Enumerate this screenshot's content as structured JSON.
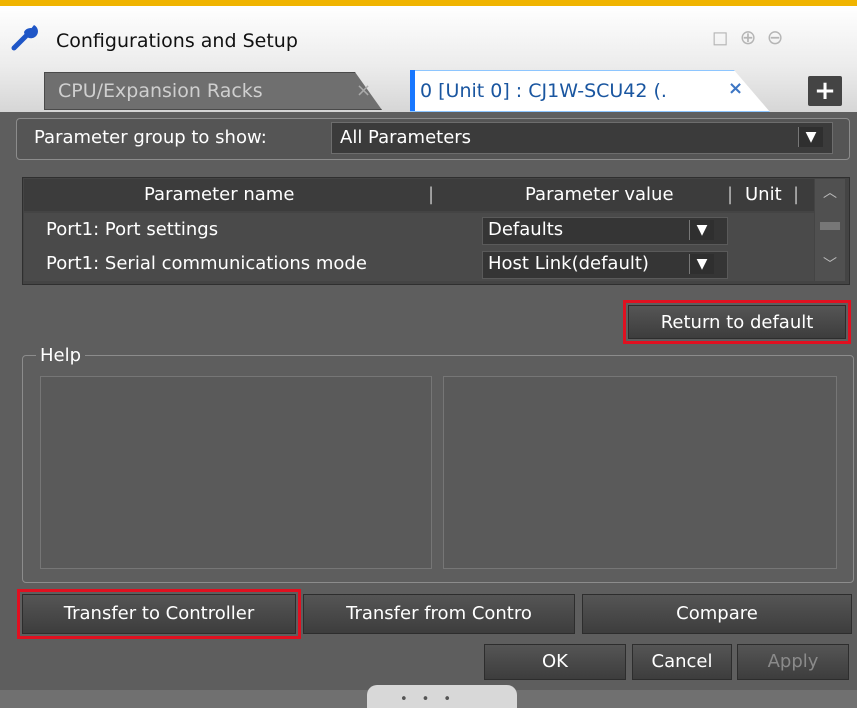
{
  "window": {
    "title": "Configurations and Setup"
  },
  "tabs": [
    {
      "label": "CPU/Expansion Racks",
      "close": "×"
    },
    {
      "label": "0 [Unit 0] : CJ1W-SCU42 (.",
      "close": "×"
    }
  ],
  "add_tab": "+",
  "parameter_group": {
    "label": "Parameter group to show:",
    "value": "All Parameters"
  },
  "table": {
    "columns": [
      "Parameter name",
      "Parameter value",
      "Unit"
    ],
    "rows": [
      {
        "name": "Port1: Port settings",
        "value": "Defaults"
      },
      {
        "name": "Port1: Serial communications mode",
        "value": "Host Link(default)"
      }
    ]
  },
  "buttons": {
    "return_default": "Return to default",
    "transfer_to": "Transfer to Controller",
    "transfer_from": "Transfer from Contro",
    "compare": "Compare",
    "ok": "OK",
    "cancel": "Cancel",
    "apply": "Apply"
  },
  "help": {
    "label": "Help"
  },
  "colors": {
    "accent": "#f0b400",
    "highlight": "#e01020",
    "tab_active_text": "#1a56a0"
  },
  "icons": [
    "wrench-icon",
    "fit-window-icon",
    "zoom-in-icon",
    "zoom-out-icon",
    "close-icon",
    "dropdown-arrow-icon",
    "scroll-up-icon",
    "scroll-down-icon"
  ]
}
